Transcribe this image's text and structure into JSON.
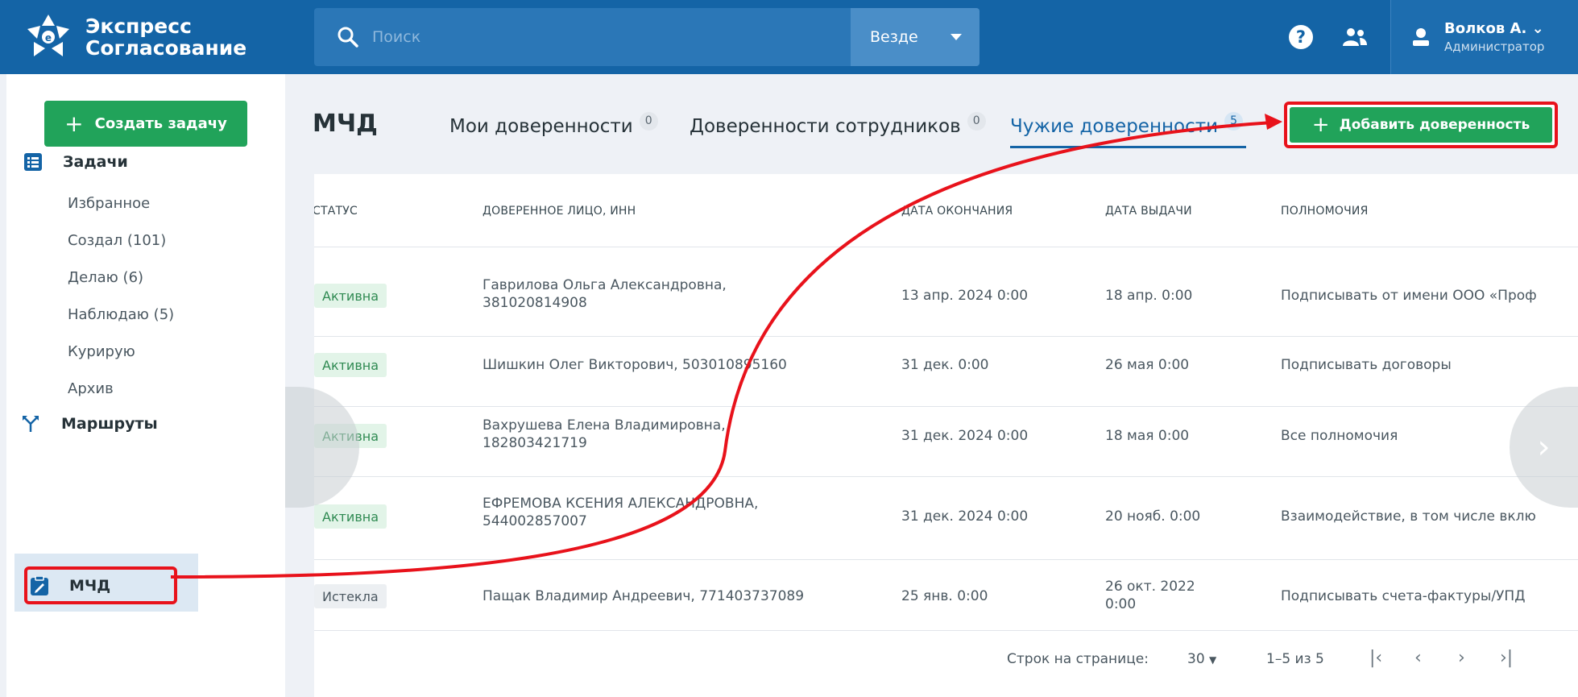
{
  "brand": {
    "line1": "Экспресс",
    "line2": "Согласование"
  },
  "search": {
    "placeholder": "Поиск",
    "scope": "Везде"
  },
  "user": {
    "name": "Волков А.",
    "role": "Администратор"
  },
  "sidebar": {
    "create_label": "Создать задачу",
    "tasks_label": "Задачи",
    "sub_items": [
      "Избранное",
      "Создал (101)",
      "Делаю (6)",
      "Наблюдаю (5)",
      "Курирую",
      "Архив"
    ],
    "routes_label": "Маршруты",
    "mchd_label": "МЧД"
  },
  "main": {
    "title": "МЧД",
    "tabs": [
      {
        "label": "Мои доверенности",
        "count": "0"
      },
      {
        "label": "Доверенности сотрудников",
        "count": "0"
      },
      {
        "label": "Чужие доверенности",
        "count": "5"
      }
    ],
    "add_label": "Добавить доверенность"
  },
  "table": {
    "columns": [
      "СТАТУС",
      "ДОВЕРЕННОЕ ЛИЦО, ИНН",
      "ДАТА ОКОНЧАНИЯ",
      "ДАТА ВЫДАЧИ",
      "ПОЛНОМОЧИЯ"
    ],
    "rows": [
      {
        "status": "Активна",
        "person_l1": "Гаврилова Ольга Александровна,",
        "person_l2": "381020814908",
        "end": "13 апр. 2024 0:00",
        "issued_l1": "18 апр. 0:00",
        "issued_l2": "",
        "powers": "Подписывать от имени ООО «Проф"
      },
      {
        "status": "Активна",
        "person_l1": "Шишкин Олег Викторович, 503010895160",
        "person_l2": "",
        "end": "31 дек. 0:00",
        "issued_l1": "26 мая 0:00",
        "issued_l2": "",
        "powers": "Подписывать договоры"
      },
      {
        "status": "Активна",
        "person_l1": "Вахрушева Елена Владимировна,",
        "person_l2": "182803421719",
        "end": "31 дек. 2024 0:00",
        "issued_l1": "18 мая 0:00",
        "issued_l2": "",
        "powers": "Все полномочия"
      },
      {
        "status": "Активна",
        "person_l1": "ЕФРЕМОВА КСЕНИЯ АЛЕКСАНДРОВНА,",
        "person_l2": "544002857007",
        "end": "31 дек. 2024 0:00",
        "issued_l1": "20 нояб. 0:00",
        "issued_l2": "",
        "powers": "Взаимодействие, в том числе вклю"
      },
      {
        "status": "Истекла",
        "person_l1": "Пащак Владимир Андреевич, 771403737089",
        "person_l2": "",
        "end": "25 янв. 0:00",
        "issued_l1": "26 окт. 2022",
        "issued_l2": "0:00",
        "powers": "Подписывать счета-фактуры/УПД"
      }
    ],
    "rows_per_page_label": "Строк на странице:",
    "rows_per_page": "30",
    "range": "1–5 из 5"
  },
  "colors": {
    "header": "#1464a6",
    "accent_green": "#21a35a",
    "highlight_red": "#e8121b",
    "active_tab": "#1464a6"
  }
}
